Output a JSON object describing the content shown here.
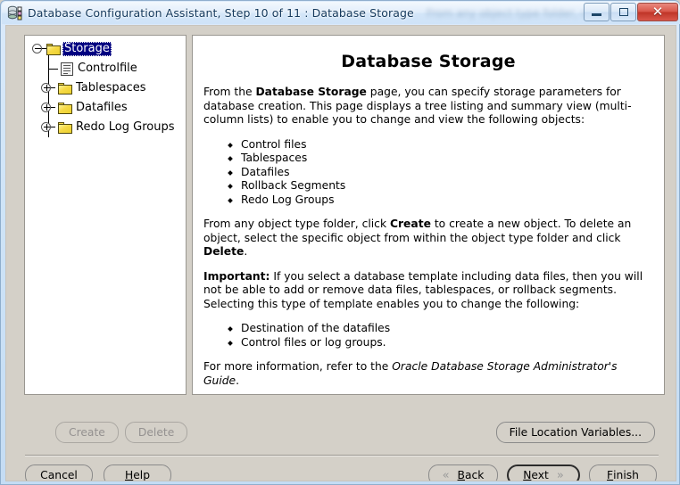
{
  "window": {
    "title": "Database Configuration Assistant, Step 10 of 11 : Database Storage",
    "icon": "database-assistant-icon",
    "ghost_text": "From any object type folder, click C",
    "controls": {
      "minimize": "minimize-icon",
      "maximize": "maximize-icon",
      "close": "✕"
    },
    "colors": {
      "titlebar_top": "#f3f8fd",
      "titlebar_bottom": "#cfe3f8",
      "frame_border": "#8faecd",
      "close_button": "#bf3427",
      "panel_face": "#d4d0c8",
      "selection": "#000080",
      "folder_yellow": "#f6d945"
    }
  },
  "tree": {
    "nodes": [
      {
        "label": "Storage",
        "icon": "folder-icon",
        "toggle": "collapse-toggle-icon",
        "expanded": true,
        "selected": true,
        "level": 0
      },
      {
        "label": "Controlfile",
        "icon": "controlfile-icon",
        "toggle": "none",
        "expanded": false,
        "selected": false,
        "level": 1
      },
      {
        "label": "Tablespaces",
        "icon": "folder-icon",
        "toggle": "expand-toggle-icon",
        "expanded": false,
        "selected": false,
        "level": 1
      },
      {
        "label": "Datafiles",
        "icon": "folder-icon",
        "toggle": "expand-toggle-icon",
        "expanded": false,
        "selected": false,
        "level": 1
      },
      {
        "label": "Redo Log Groups",
        "icon": "folder-icon",
        "toggle": "expand-toggle-icon",
        "expanded": false,
        "selected": false,
        "level": 1
      }
    ]
  },
  "content": {
    "page_title": "Database Storage",
    "paragraph1_pre": "From the ",
    "paragraph1_bold": "Database Storage",
    "paragraph1_post": " page, you can specify storage parameters for database creation. This page displays a tree listing and summary view (multi-column lists) to enable you to change and view the following objects:",
    "object_list": [
      "Control files",
      "Tablespaces",
      "Datafiles",
      "Rollback Segments",
      "Redo Log Groups"
    ],
    "paragraph2_pre": "From any object type folder, click ",
    "paragraph2_bold1": "Create",
    "paragraph2_mid": " to create a new object. To delete an object, select the specific object from within the object type folder and click ",
    "paragraph2_bold2": "Delete",
    "paragraph2_post": ".",
    "paragraph3_bold": "Important:",
    "paragraph3_post": " If you select a database template including data files, then you will not be able to add or remove data files, tablespaces, or rollback segments. Selecting this type of template enables you to change the following:",
    "change_list": [
      "Destination of the datafiles",
      "Control files or log groups."
    ],
    "paragraph4_pre": "For more information, refer to the ",
    "paragraph4_italic": "Oracle Database Storage Administrator's Guide",
    "paragraph4_post": "."
  },
  "buttons": {
    "create": {
      "label": "Create",
      "enabled": false
    },
    "delete": {
      "label": "Delete",
      "enabled": false
    },
    "file_location_variables": {
      "label": "File Location Variables...",
      "enabled": true
    },
    "cancel": {
      "label": "Cancel",
      "mnemonic": "",
      "enabled": true
    },
    "help": {
      "label": "Help",
      "mnemonic": "H",
      "enabled": true
    },
    "back": {
      "label": "Back",
      "mnemonic": "B",
      "enabled": true,
      "chevron": "«"
    },
    "next": {
      "label": "Next",
      "mnemonic": "N",
      "enabled": true,
      "chevron": "»",
      "default": true
    },
    "finish": {
      "label": "Finish",
      "mnemonic": "F",
      "enabled": true
    }
  }
}
